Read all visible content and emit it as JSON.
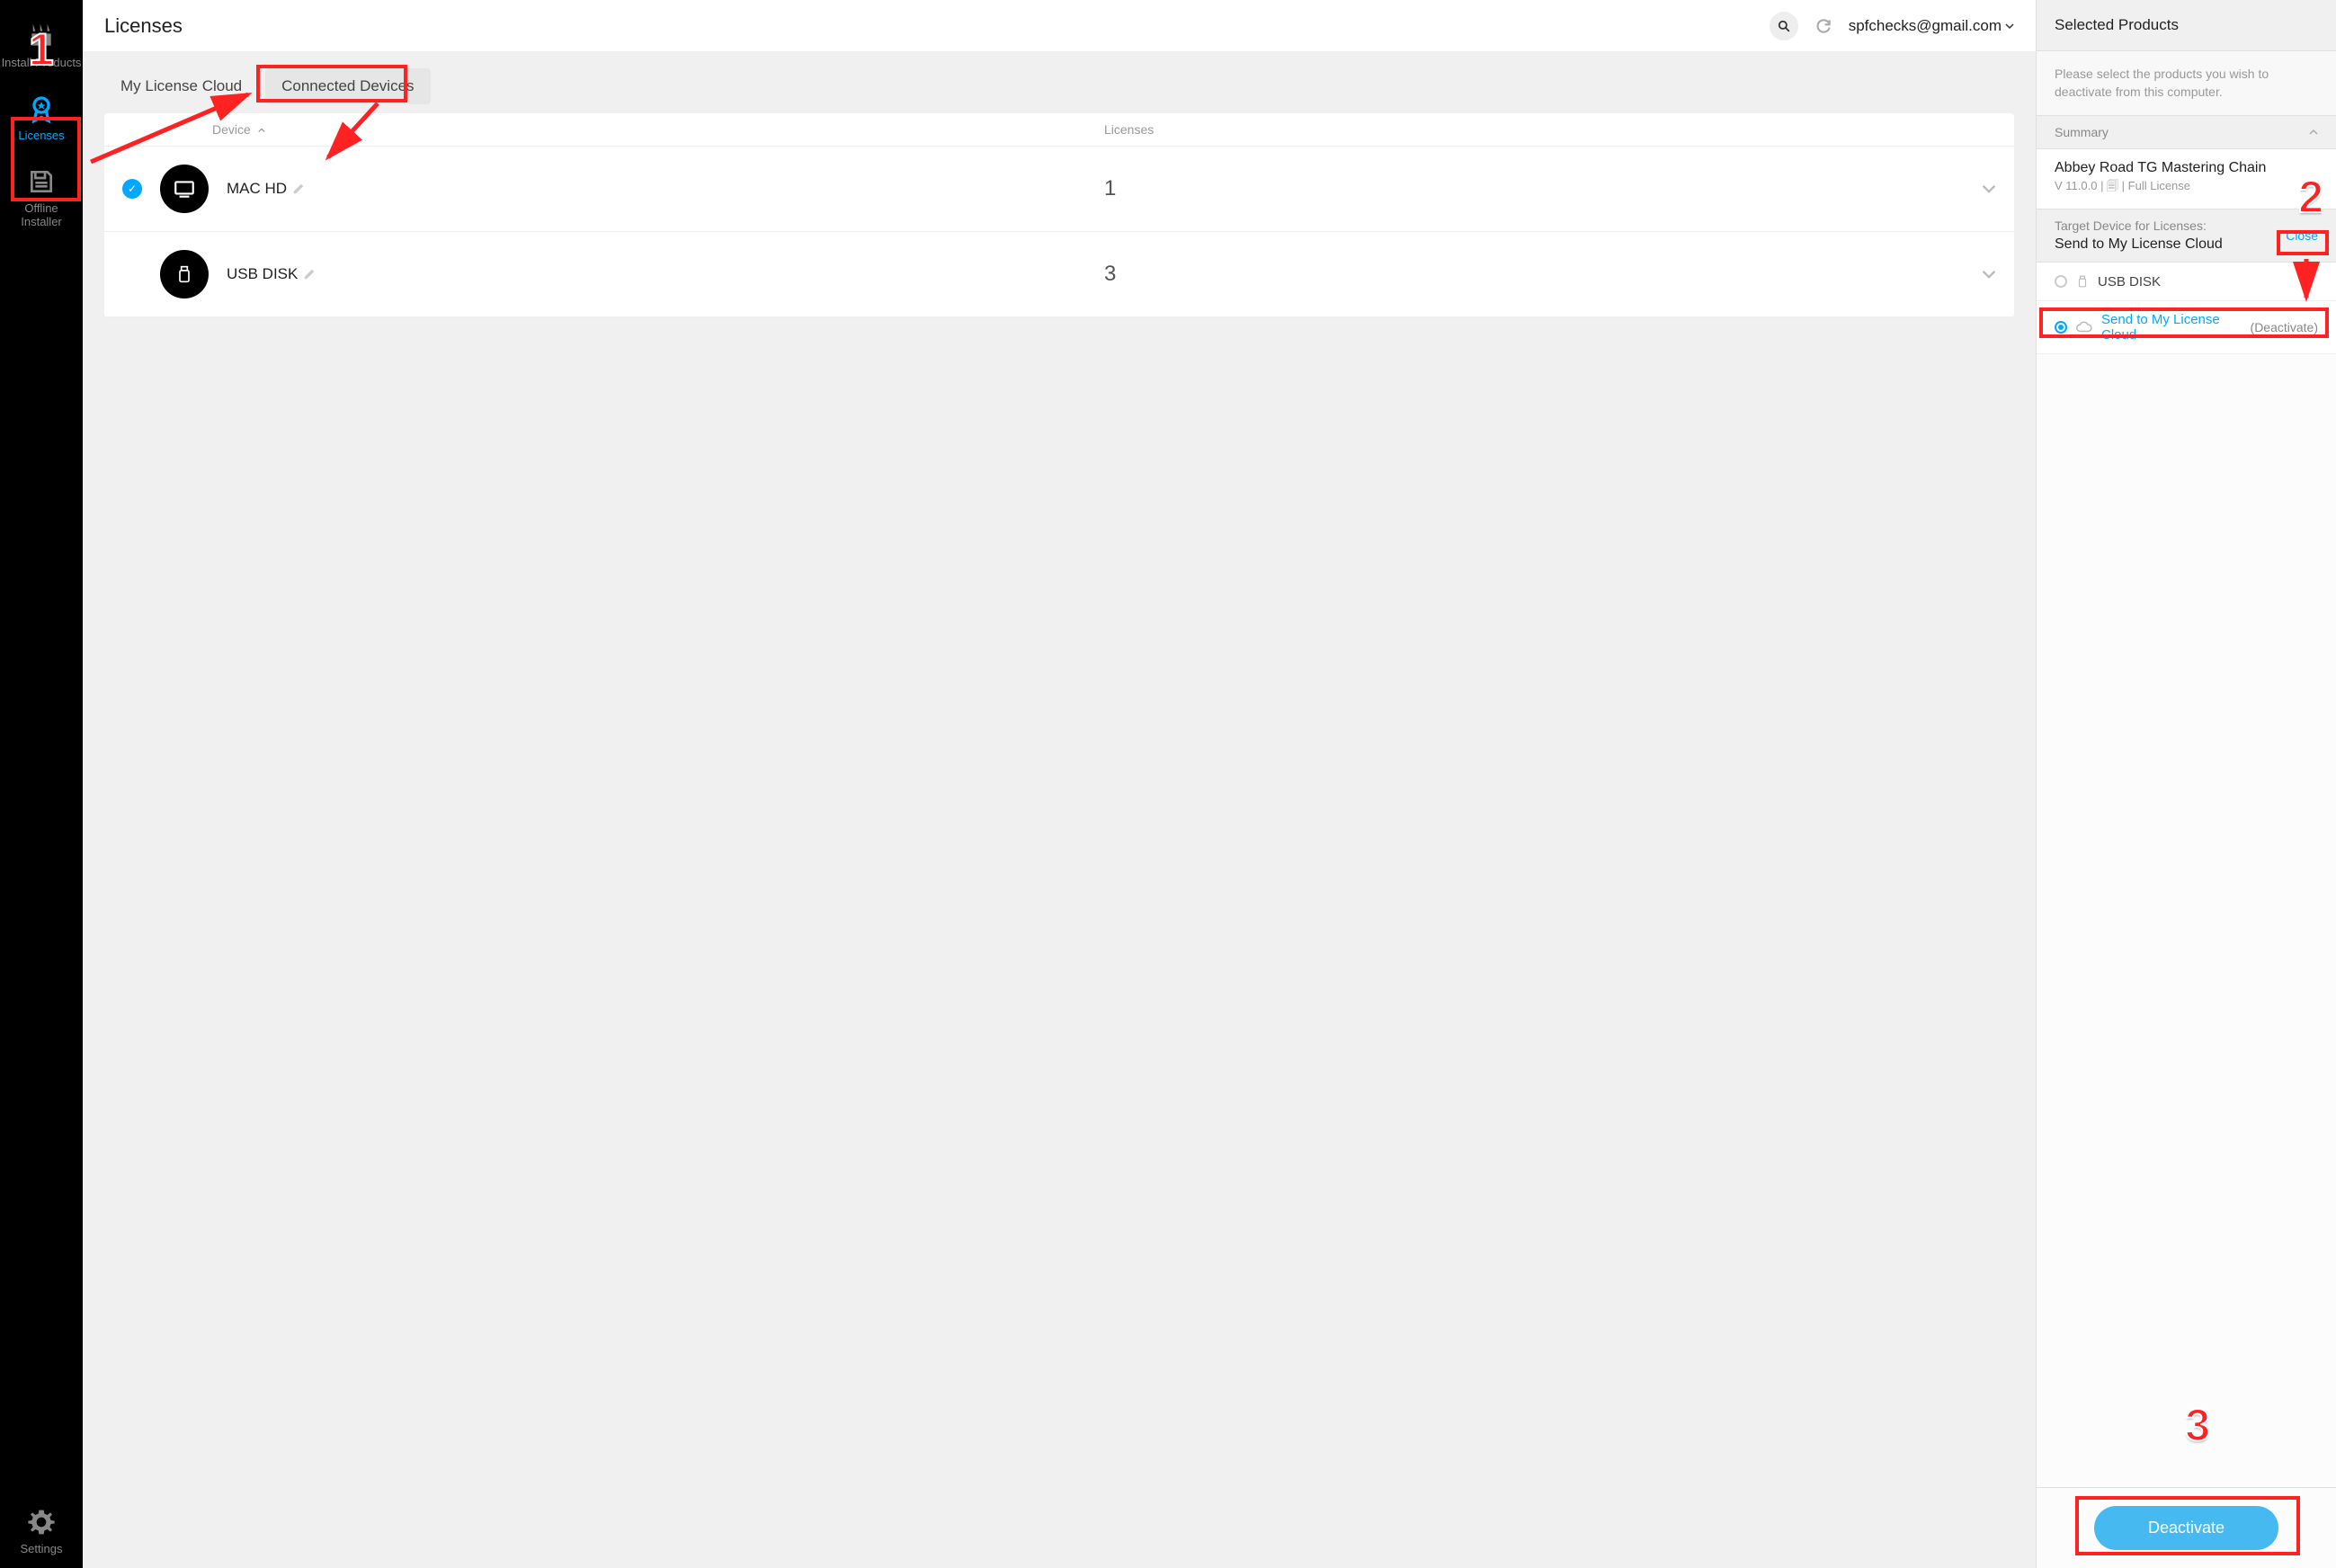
{
  "sidebar": {
    "install_label": "Install Products",
    "licenses_label": "Licenses",
    "offline_label_line1": "Offline",
    "offline_label_line2": "Installer",
    "settings_label": "Settings"
  },
  "header": {
    "title": "Licenses",
    "account": "spfchecks@gmail.com"
  },
  "tabs": {
    "cloud": "My License Cloud",
    "devices": "Connected Devices"
  },
  "table": {
    "col_device": "Device",
    "col_licenses": "Licenses",
    "rows": [
      {
        "name": "MAC HD",
        "count": "1",
        "checked": true,
        "kind": "computer"
      },
      {
        "name": "USB DISK",
        "count": "3",
        "checked": false,
        "kind": "usb"
      }
    ]
  },
  "panel": {
    "title": "Selected Products",
    "note": "Please select the products you wish to deactivate from this computer.",
    "summary_label": "Summary",
    "product": {
      "name": "Abbey Road TG Mastering Chain",
      "meta": "V 11.0.0 | 🗐 | Full License"
    },
    "target_label": "Target Device for Licenses:",
    "target_value": "Send to My License Cloud",
    "close": "Close",
    "options": [
      {
        "label": "USB DISK",
        "selected": false,
        "icon": "usb",
        "suffix": ""
      },
      {
        "label": "Send to My License Cloud",
        "selected": true,
        "icon": "cloud",
        "suffix": "(Deactivate)"
      }
    ],
    "button": "Deactivate"
  },
  "annotations": {
    "n1": "1",
    "n2": "2",
    "n3": "3"
  }
}
